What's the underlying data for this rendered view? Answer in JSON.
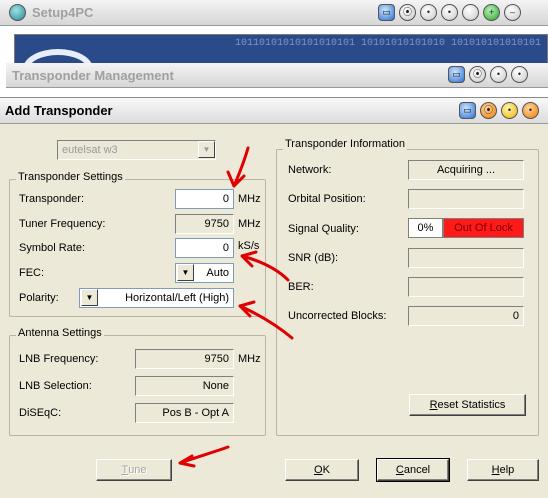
{
  "bg_window_1": {
    "title": "Setup4PC"
  },
  "banner": {
    "binary_text": "10110101010101010101 10101010101010 101010101010101"
  },
  "bg_window_2": {
    "title": "Transponder Management"
  },
  "dialog": {
    "title": "Add Transponder"
  },
  "satellite_select": {
    "value": "eutelsat w3"
  },
  "transponder_settings": {
    "legend": "Transponder Settings",
    "transponder": {
      "label": "Transponder:",
      "value": "0",
      "unit": "MHz"
    },
    "tuner_frequency": {
      "label": "Tuner Frequency:",
      "value": "9750",
      "unit": "MHz"
    },
    "symbol_rate": {
      "label": "Symbol Rate:",
      "value": "0",
      "unit": "kS/s"
    },
    "fec": {
      "label": "FEC:",
      "value": "Auto"
    },
    "polarity": {
      "label": "Polarity:",
      "value": "Horizontal/Left (High)"
    }
  },
  "antenna_settings": {
    "legend": "Antenna Settings",
    "lnb_frequency": {
      "label": "LNB Frequency:",
      "value": "9750",
      "unit": "MHz"
    },
    "lnb_selection": {
      "label": "LNB Selection:",
      "value": "None"
    },
    "diseqc": {
      "label": "DiSEqC:",
      "value": "Pos B - Opt A"
    }
  },
  "transponder_info": {
    "legend": "Transponder Information",
    "network": {
      "label": "Network:",
      "value": "Acquiring ..."
    },
    "orbital_position": {
      "label": "Orbital Position:",
      "value": ""
    },
    "signal_quality": {
      "label": "Signal Quality:",
      "percent": "0%",
      "status": "Out Of Lock"
    },
    "snr": {
      "label": "SNR (dB):",
      "value": ""
    },
    "ber": {
      "label": "BER:",
      "value": ""
    },
    "uncorrected_blocks": {
      "label": "Uncorrected Blocks:",
      "value": "0"
    },
    "reset_button": {
      "first": "R",
      "rest": "eset Statistics"
    }
  },
  "buttons": {
    "tune": {
      "first": "T",
      "rest": "une"
    },
    "ok": {
      "first": "O",
      "rest": "K"
    },
    "cancel": {
      "first": "C",
      "rest": "ancel"
    },
    "help": {
      "first": "H",
      "rest": "elp"
    }
  },
  "colors": {
    "dialog_bg": "#ece9d8",
    "out_of_lock": "#ff1a1a",
    "annotation_arrows": "#e00000"
  }
}
